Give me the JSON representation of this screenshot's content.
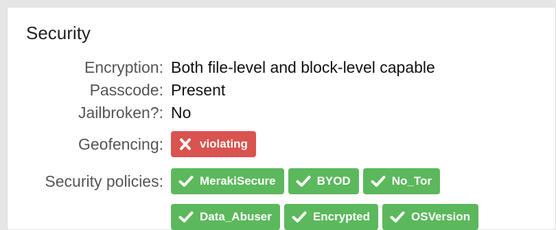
{
  "colors": {
    "violating": "#d9534f",
    "policy": "#5cb85c"
  },
  "security": {
    "title": "Security",
    "encryption_label": "Encryption:",
    "encryption_value": "Both file-level and block-level capable",
    "passcode_label": "Passcode:",
    "passcode_value": "Present",
    "jailbroken_label": "Jailbroken?:",
    "jailbroken_value": "No",
    "geofencing_label": "Geofencing:",
    "geofencing_status": "violating",
    "geofencing_icon": "x-icon",
    "policies_label": "Security policies:",
    "policies": [
      {
        "label": "MerakiSecure",
        "icon": "check-icon"
      },
      {
        "label": "BYOD",
        "icon": "check-icon"
      },
      {
        "label": "No_Tor",
        "icon": "check-icon"
      },
      {
        "label": "Data_Abuser",
        "icon": "check-icon"
      },
      {
        "label": "Encrypted",
        "icon": "check-icon"
      },
      {
        "label": "OSVersion",
        "icon": "check-icon"
      }
    ]
  }
}
